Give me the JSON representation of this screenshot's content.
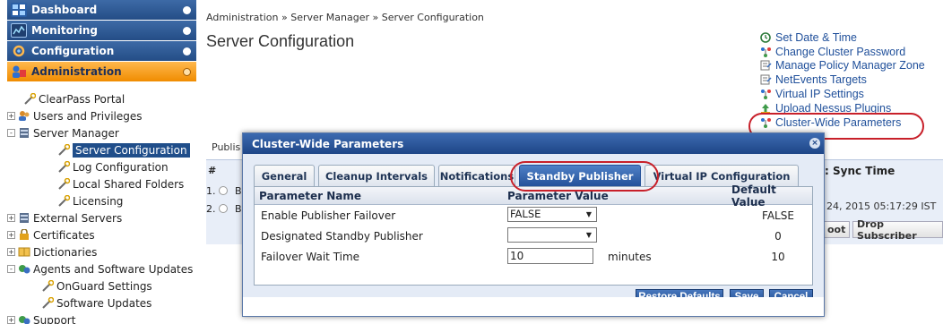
{
  "colors": {
    "nav_blue": "#244d86",
    "nav_active": "#f08c00",
    "link": "#1f4f9a",
    "highlight_oval": "#c8202a",
    "tab_active": "#24529a"
  },
  "sidebar": {
    "nav": [
      {
        "label": "Dashboard",
        "icon": "dashboard-icon",
        "active": false
      },
      {
        "label": "Monitoring",
        "icon": "monitoring-icon",
        "active": false
      },
      {
        "label": "Configuration",
        "icon": "configuration-icon",
        "active": false
      },
      {
        "label": "Administration",
        "icon": "administration-icon",
        "active": true
      }
    ],
    "tree": [
      {
        "label": "ClearPass Portal",
        "icon": "wrench-icon",
        "expander": ""
      },
      {
        "label": "Users and Privileges",
        "icon": "users-icon",
        "expander": "+"
      },
      {
        "label": "Server Manager",
        "icon": "server-icon",
        "expander": "-"
      },
      {
        "label": "Server Configuration",
        "icon": "wrench-icon",
        "expander": ""
      },
      {
        "label": "Log Configuration",
        "icon": "wrench-icon",
        "expander": ""
      },
      {
        "label": "Local Shared Folders",
        "icon": "wrench-icon",
        "expander": ""
      },
      {
        "label": "Licensing",
        "icon": "wrench-icon",
        "expander": ""
      },
      {
        "label": "External Servers",
        "icon": "server-icon",
        "expander": "+"
      },
      {
        "label": "Certificates",
        "icon": "certificate-icon",
        "expander": "+"
      },
      {
        "label": "Dictionaries",
        "icon": "book-icon",
        "expander": "+"
      },
      {
        "label": "Agents and Software Updates",
        "icon": "agents-icon",
        "expander": "-"
      },
      {
        "label": "OnGuard Settings",
        "icon": "wrench-icon",
        "expander": ""
      },
      {
        "label": "Software Updates",
        "icon": "wrench-icon",
        "expander": ""
      },
      {
        "label": "Support",
        "icon": "agents-icon",
        "expander": "+"
      }
    ]
  },
  "header": {
    "breadcrumb": "Administration » Server Manager » Server Configuration",
    "title": "Server Configuration"
  },
  "actions": [
    {
      "label": "Set Date & Time",
      "icon": "clock-icon"
    },
    {
      "label": "Change Cluster Password",
      "icon": "cluster-icon"
    },
    {
      "label": "Manage Policy Manager Zone",
      "icon": "document-icon"
    },
    {
      "label": "NetEvents Targets",
      "icon": "document-icon"
    },
    {
      "label": "Virtual IP Settings",
      "icon": "cluster-icon"
    },
    {
      "label": "Upload Nessus Plugins",
      "icon": "upload-icon"
    },
    {
      "label": "Cluster-Wide Parameters",
      "icon": "cluster-icon"
    }
  ],
  "background_table": {
    "caption": "Publis",
    "hash": "#",
    "rows": [
      "1.",
      "2."
    ],
    "row_letter": "B",
    "sync_header": ": Sync Time",
    "sync_value": "24, 2015 05:17:29 IST",
    "buttons": [
      "oot",
      "Drop Subscriber"
    ]
  },
  "modal": {
    "title": "Cluster-Wide Parameters",
    "close": "×",
    "tabs": [
      "General",
      "Cleanup Intervals",
      "Notifications",
      "Standby Publisher",
      "Virtual IP Configuration"
    ],
    "active_tab": "Standby Publisher",
    "columns": {
      "name": "Parameter Name",
      "value": "Parameter Value",
      "default": "Default Value"
    },
    "params": [
      {
        "name": "Enable Publisher Failover",
        "value": "FALSE",
        "type": "select",
        "unit": "",
        "default": "FALSE"
      },
      {
        "name": "Designated Standby Publisher",
        "value": "",
        "type": "select",
        "unit": "",
        "default": "0"
      },
      {
        "name": "Failover Wait Time",
        "value": "10",
        "type": "text",
        "unit": "minutes",
        "default": "10"
      }
    ],
    "buttons": {
      "restore": "Restore Defaults",
      "save": "Save",
      "cancel": "Cancel"
    }
  }
}
